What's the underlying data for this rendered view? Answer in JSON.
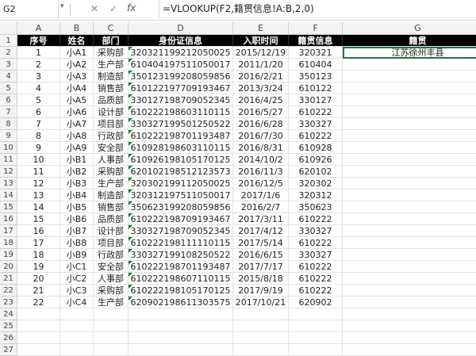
{
  "name_box": "G2",
  "formula": "=VLOOKUP(F2,籍贯信息!A:B,2,0)",
  "icons": {
    "cancel": "close-icon",
    "confirm": "check-icon",
    "fx": "fx-icon"
  },
  "columns": [
    "A",
    "B",
    "C",
    "D",
    "E",
    "F",
    "G"
  ],
  "headers": [
    "序号",
    "姓名",
    "部门",
    "身份证信息",
    "入职时间",
    "籍贯信息",
    "籍贯"
  ],
  "rows": [
    [
      "1",
      "小A1",
      "采购部",
      "320321199212050025",
      "2015/12/19",
      "320321",
      "江苏徐州丰县"
    ],
    [
      "2",
      "小A2",
      "生产部",
      "610404197511050017",
      "2011/1/20",
      "610404",
      ""
    ],
    [
      "3",
      "小A3",
      "制造部",
      "350123199208059856",
      "2016/2/21",
      "350123",
      ""
    ],
    [
      "4",
      "小A4",
      "销售部",
      "610122197709193467",
      "2013/3/24",
      "610122",
      ""
    ],
    [
      "5",
      "小A5",
      "品质部",
      "330127198709052345",
      "2016/4/25",
      "330127",
      ""
    ],
    [
      "6",
      "小A6",
      "设计部",
      "610222198603110115",
      "2016/5/27",
      "610222",
      ""
    ],
    [
      "7",
      "小A7",
      "项目部",
      "330327199501250522",
      "2016/6/28",
      "330327",
      ""
    ],
    [
      "8",
      "小A8",
      "行政部",
      "610222198701193487",
      "2016/7/30",
      "610222",
      ""
    ],
    [
      "9",
      "小A9",
      "安全部",
      "610928198603110115",
      "2016/8/31",
      "610928",
      ""
    ],
    [
      "10",
      "小B1",
      "人事部",
      "610926198105170125",
      "2014/10/2",
      "610926",
      ""
    ],
    [
      "11",
      "小B2",
      "采购部",
      "620102198512123573",
      "2016/11/3",
      "620102",
      ""
    ],
    [
      "12",
      "小B3",
      "生产部",
      "320302199112050025",
      "2016/12/5",
      "320302",
      ""
    ],
    [
      "13",
      "小B4",
      "制造部",
      "320312197511050017",
      "2017/1/6",
      "320312",
      ""
    ],
    [
      "14",
      "小B5",
      "销售部",
      "350623199208059856",
      "2016/2/7",
      "350623",
      ""
    ],
    [
      "15",
      "小B6",
      "品质部",
      "610222198709193467",
      "2017/3/11",
      "610222",
      ""
    ],
    [
      "16",
      "小B7",
      "设计部",
      "330327198709052345",
      "2017/4/12",
      "330327",
      ""
    ],
    [
      "17",
      "小B8",
      "项目部",
      "610222198111110115",
      "2017/5/14",
      "610222",
      ""
    ],
    [
      "18",
      "小B9",
      "行政部",
      "330327199108250522",
      "2016/6/15",
      "330327",
      ""
    ],
    [
      "19",
      "小C1",
      "安全部",
      "610222198701193487",
      "2017/7/17",
      "610222",
      ""
    ],
    [
      "20",
      "小C2",
      "人事部",
      "610222198607110115",
      "2015/8/18",
      "610222",
      ""
    ],
    [
      "21",
      "小C3",
      "采购部",
      "610222198105170125",
      "2017/9/19",
      "610222",
      ""
    ],
    [
      "22",
      "小C4",
      "生产部",
      "620902198611303575",
      "2017/10/21",
      "620902",
      ""
    ]
  ],
  "row_numbers": [
    "1",
    "2",
    "3",
    "4",
    "5",
    "6",
    "7",
    "8",
    "9",
    "10",
    "11",
    "12",
    "13",
    "14",
    "15",
    "16",
    "17",
    "18",
    "19",
    "20",
    "21",
    "22",
    "23",
    "24",
    "25",
    "26",
    "27"
  ]
}
